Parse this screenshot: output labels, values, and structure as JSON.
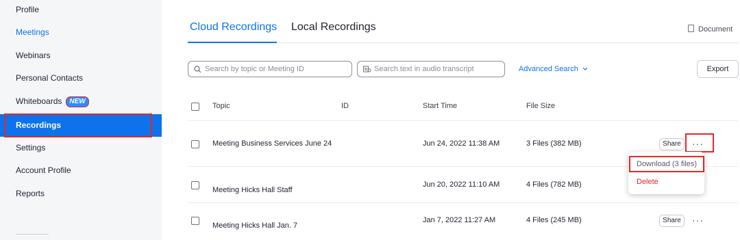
{
  "sidebar": {
    "items": [
      {
        "label": "Profile"
      },
      {
        "label": "Meetings"
      },
      {
        "label": "Webinars"
      },
      {
        "label": "Personal Contacts"
      },
      {
        "label": "Whiteboards",
        "badge": "NEW"
      },
      {
        "label": "Recordings"
      },
      {
        "label": "Settings"
      },
      {
        "label": "Account Profile"
      },
      {
        "label": "Reports"
      }
    ]
  },
  "tabs": [
    {
      "label": "Cloud Recordings"
    },
    {
      "label": "Local Recordings"
    }
  ],
  "doc_link": "Document",
  "search": {
    "topic_placeholder": "Search by topic or Meeting ID",
    "transcript_placeholder": "Search text in audio transcript",
    "advanced_label": "Advanced Search",
    "export_label": "Export"
  },
  "table": {
    "headers": {
      "topic": "Topic",
      "id": "ID",
      "start": "Start Time",
      "size": "File Size"
    },
    "rows": [
      {
        "topic": "Meeting Business Services June 24",
        "start": "Jun 24, 2022 11:38 AM",
        "size": "3 Files (382 MB)",
        "share": "Share"
      },
      {
        "topic": "Meeting Hicks Hall Staff",
        "start": "Jun 20, 2022 11:10 AM",
        "size": "4 Files (782 MB)"
      },
      {
        "topic": "Meeting Hicks Hall Jan. 7",
        "start": "Jan 7, 2022 11:27 AM",
        "size": "4 Files (245 MB)",
        "share": "Share"
      }
    ]
  },
  "menu": {
    "download": "Download (3 files)",
    "delete": "Delete"
  },
  "colors": {
    "accent": "#0e72ed",
    "highlight": "#e02828",
    "danger": "#e02828"
  }
}
